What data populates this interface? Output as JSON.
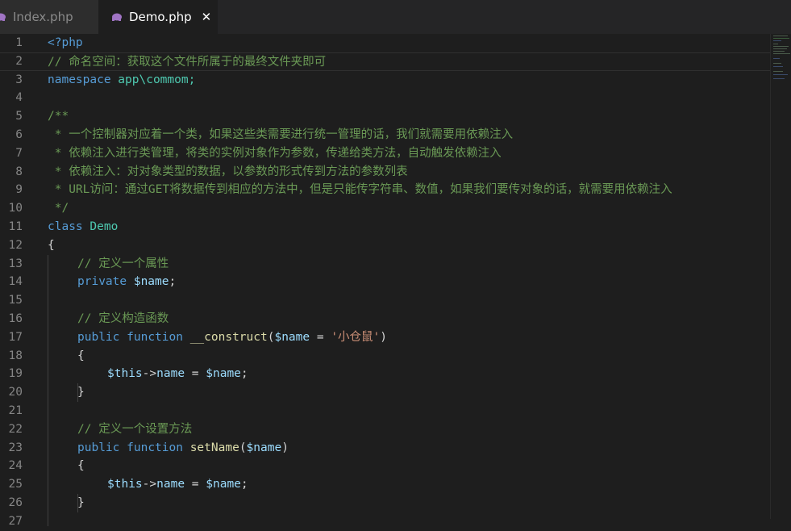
{
  "tabs": [
    {
      "label": "Index.php",
      "active": false,
      "icon": "php-elephant-icon"
    },
    {
      "label": "Demo.php",
      "active": true,
      "icon": "php-elephant-icon",
      "close_glyph": "✕"
    }
  ],
  "editor": {
    "line_numbers": [
      "1",
      "2",
      "3",
      "4",
      "5",
      "6",
      "7",
      "8",
      "9",
      "10",
      "11",
      "12",
      "13",
      "14",
      "15",
      "16",
      "17",
      "18",
      "19",
      "20",
      "21",
      "22",
      "23",
      "24",
      "25",
      "26",
      "27"
    ],
    "lines": {
      "l1_open": "<?php",
      "l2_comment": "// 命名空间：获取这个文件所属于的最终文件夹即可",
      "l3_kw": "namespace",
      "l3_rest": " app\\commom;",
      "l5": "/**",
      "l6": " * 一个控制器对应着一个类，如果这些类需要进行统一管理的话，我们就需要用依赖注入",
      "l7": " * 依赖注入进行类管理，将类的实例对象作为参数，传递给类方法，自动触发依赖注入",
      "l8": " * 依赖注入：对对象类型的数据，以参数的形式传到方法的参数列表",
      "l9": " * URL访问：通过GET将数据传到相应的方法中，但是只能传字符串、数值，如果我们要传对象的话，就需要用依赖注入",
      "l10": " */",
      "l11_kw": "class",
      "l11_name": "Demo",
      "l12": "{",
      "l13": "// 定义一个属性",
      "l14_kw": "private",
      "l14_var": "$name",
      "l14_end": ";",
      "l16": "// 定义构造函数",
      "l17_kw1": "public",
      "l17_kw2": "function",
      "l17_fn": "__construct",
      "l17_p1": "(",
      "l17_var": "$name",
      "l17_eq": " = ",
      "l17_str": "'小仓鼠'",
      "l17_p2": ")",
      "l18": "{",
      "l19_this": "$this",
      "l19_arrow": "->",
      "l19_prop": "name",
      "l19_eq": " = ",
      "l19_var": "$name",
      "l19_end": ";",
      "l20": "}",
      "l22": "// 定义一个设置方法",
      "l23_kw1": "public",
      "l23_kw2": "function",
      "l23_fn": "setName",
      "l23_p1": "(",
      "l23_var": "$name",
      "l23_p2": ")",
      "l24": "{",
      "l25_this": "$this",
      "l25_arrow": "->",
      "l25_prop": "name",
      "l25_eq": " = ",
      "l25_var": "$name",
      "l25_end": ";",
      "l26": "}"
    }
  },
  "colors": {
    "background": "#1e1e1e",
    "comment": "#6a9955",
    "keyword": "#569cd6",
    "function": "#dcdcaa",
    "variable": "#9cdcfe",
    "class": "#4ec9b0",
    "string": "#ce9178",
    "line_number": "#858585"
  }
}
